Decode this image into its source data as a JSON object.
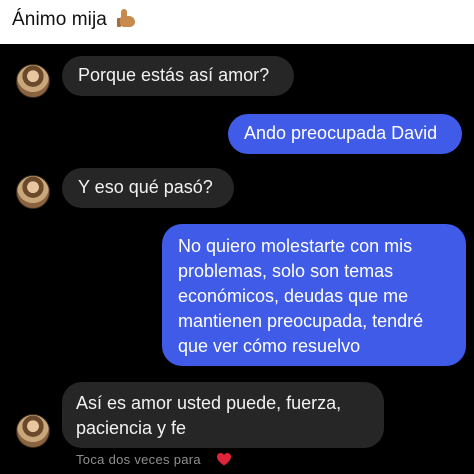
{
  "caption": {
    "text": "Ánimo mija",
    "emoji_icon": "thumbs-up-icon"
  },
  "messages": [
    {
      "side": "received",
      "text": "Porque estás así amor?"
    },
    {
      "side": "sent",
      "text": "Ando preocupada David"
    },
    {
      "side": "received",
      "text": "Y eso qué pasó?"
    },
    {
      "side": "sent",
      "text": "No quiero molestarte con mis problemas, solo son temas económicos, deudas que me mantienen preocupada, tendré que ver cómo resuelvo"
    },
    {
      "side": "received",
      "text": "Así es amor usted puede, fuerza, paciencia y fe"
    }
  ],
  "hint": {
    "text": "Toca dos veces para",
    "icon": "heart-icon"
  },
  "colors": {
    "sent_bubble": "#3f5be8",
    "received_bubble": "#262626",
    "heart": "#e0243a",
    "background": "#000000"
  }
}
